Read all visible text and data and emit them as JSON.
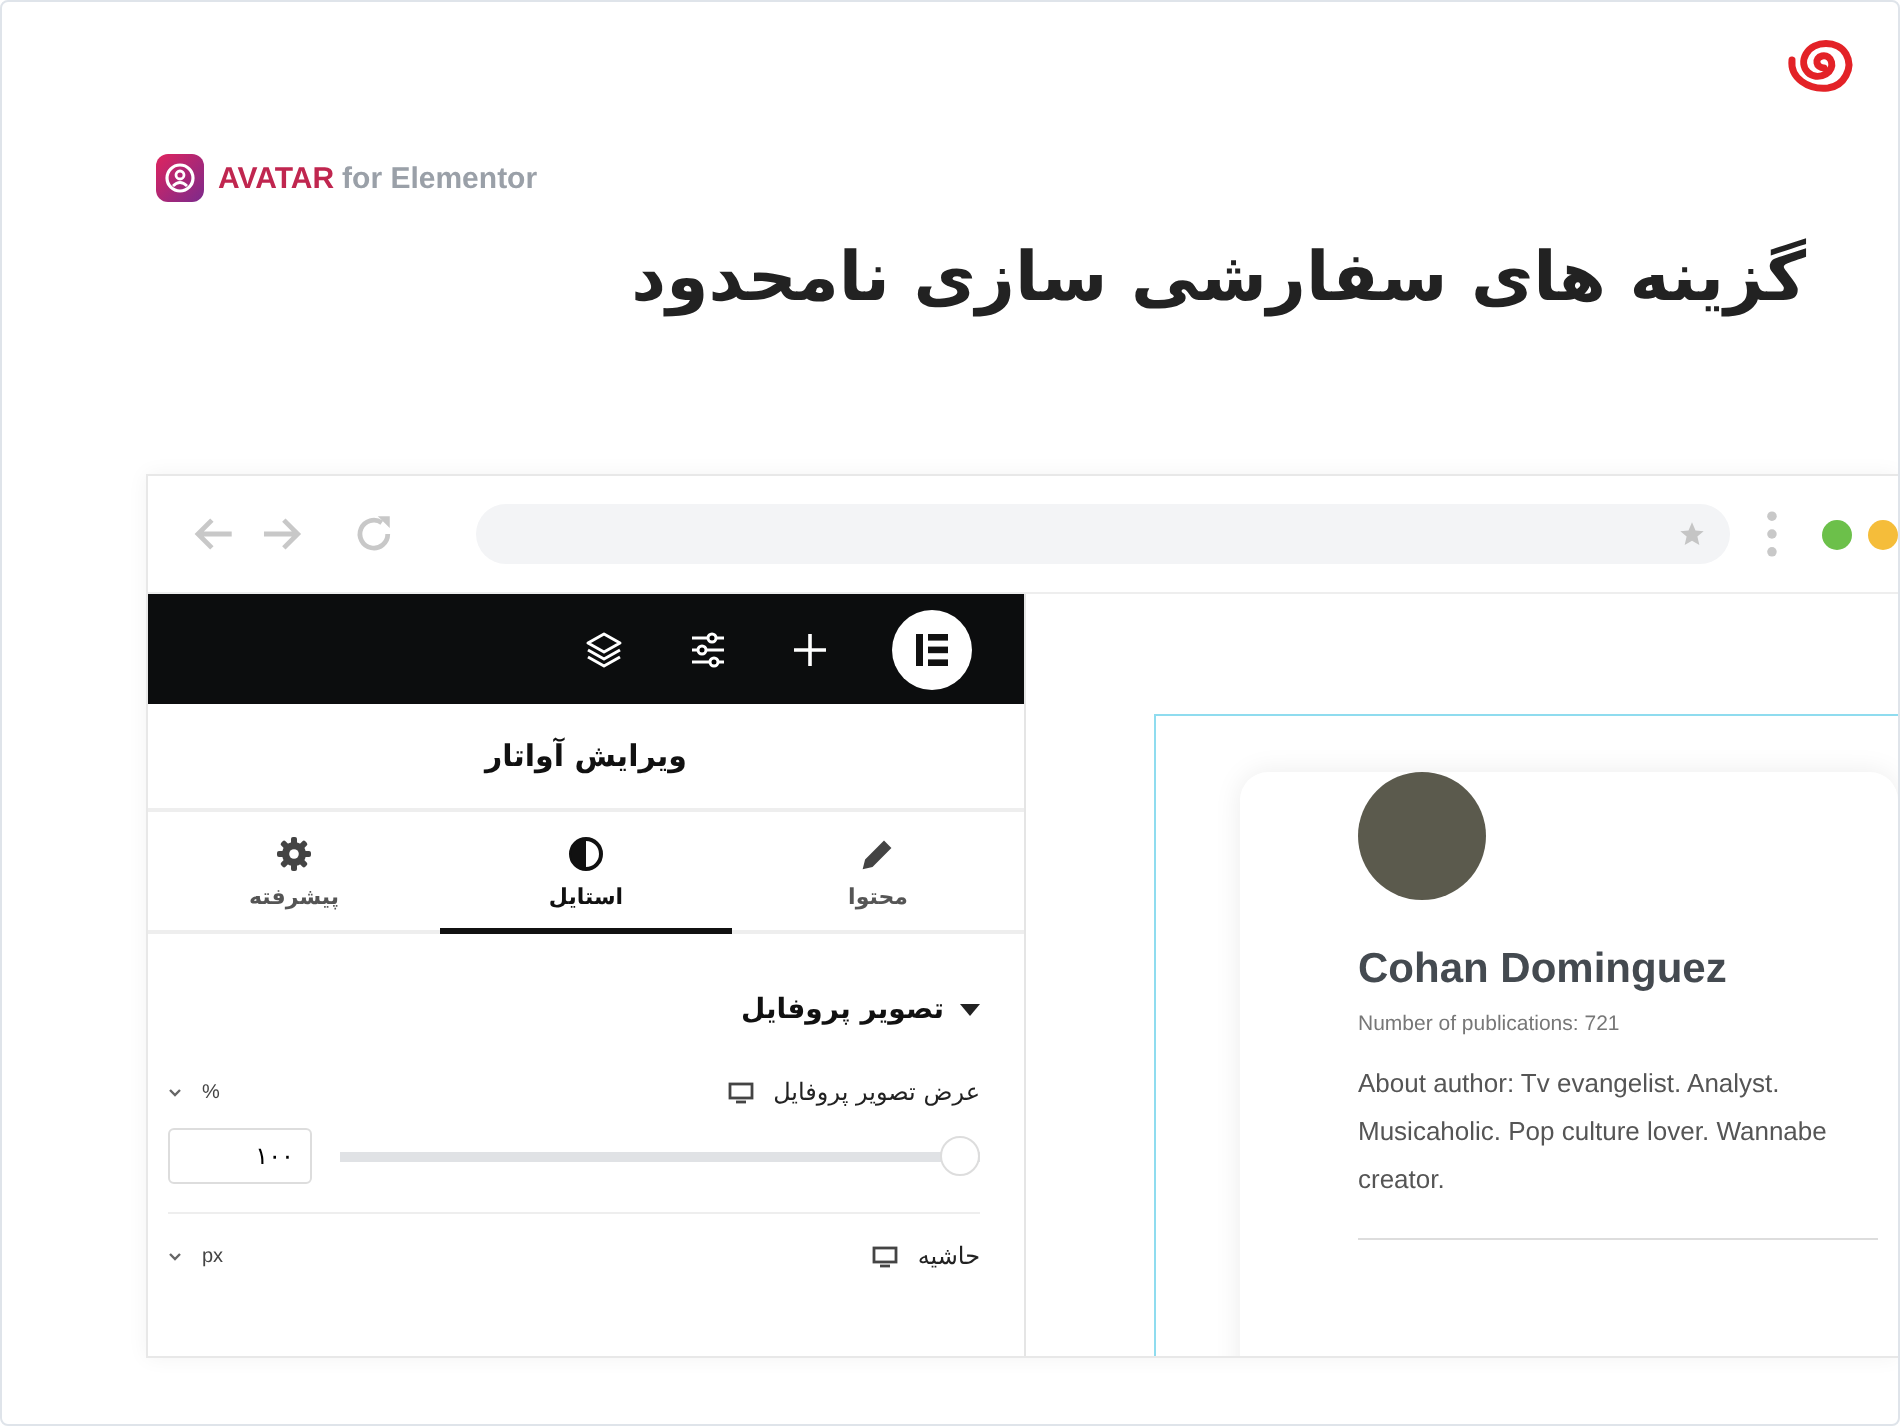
{
  "brand": {
    "name": "AVATAR",
    "suffix": "for Elementor"
  },
  "headline": "گزینه های سفارشی سازی نامحدود",
  "browser": {
    "window_dots": [
      {
        "color": "#6cc04a"
      },
      {
        "color": "#f5bd3a"
      }
    ]
  },
  "editor": {
    "title": "ویرایش آواتار",
    "tabs": [
      {
        "label": "محتوا",
        "selected": false
      },
      {
        "label": "استایل",
        "selected": true
      },
      {
        "label": "پیشرفته",
        "selected": false
      }
    ],
    "section": {
      "title": "تصویر پروفایل",
      "expanded": true
    },
    "controls": [
      {
        "kind": "slider",
        "label": "عرض تصویر پروفایل",
        "unit": "%",
        "level": 1,
        "value": "۱۰۰"
      },
      {
        "kind": "dimension",
        "label": "حاشیه",
        "unit": "px"
      }
    ]
  },
  "profile": {
    "name": "Cohan Dominguez",
    "publications": "Number of publications: 721",
    "bio": "About author: Tv evangelist. Analyst. Musicaholic. Pop culture lover. Wannabe creator."
  }
}
